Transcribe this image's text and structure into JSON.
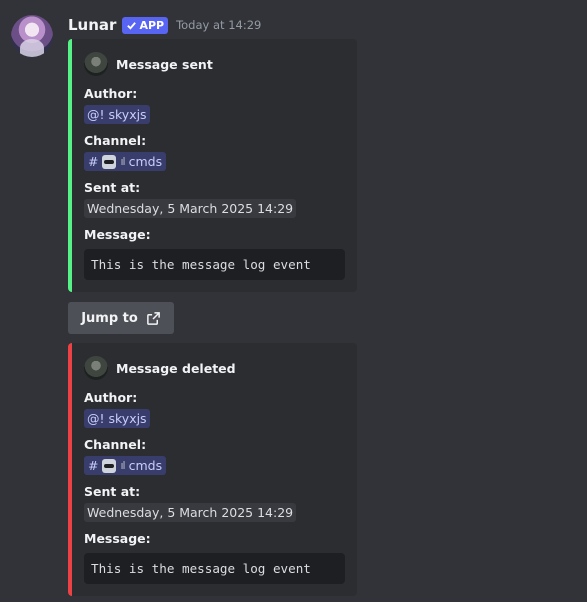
{
  "message": {
    "username": "Lunar",
    "badge": "APP",
    "timestamp": "Today at 14:29"
  },
  "embeds": [
    {
      "color": "#57f287",
      "title": "Message sent",
      "author_label": "Author:",
      "author_value": "@! skyxjs",
      "channel_label": "Channel:",
      "channel_name": "cmds",
      "channel_divider": "ıl",
      "sent_label": "Sent at:",
      "sent_value": "Wednesday, 5 March 2025 14:29",
      "message_label": "Message:",
      "message_value": "This is the message log event"
    },
    {
      "color": "#ed4245",
      "title": "Message deleted",
      "author_label": "Author:",
      "author_value": "@! skyxjs",
      "channel_label": "Channel:",
      "channel_name": "cmds",
      "channel_divider": "ıl",
      "sent_label": "Sent at:",
      "sent_value": "Wednesday, 5 March 2025 14:29",
      "message_label": "Message:",
      "message_value": "This is the message log event"
    }
  ],
  "jump_button": {
    "label": "Jump to",
    "icon": "external-link-icon"
  },
  "icons": {
    "avatar": "bot-avatar",
    "badge_check": "check-icon",
    "channel_hash": "hash-icon",
    "channel_emoji": "robot-icon"
  }
}
